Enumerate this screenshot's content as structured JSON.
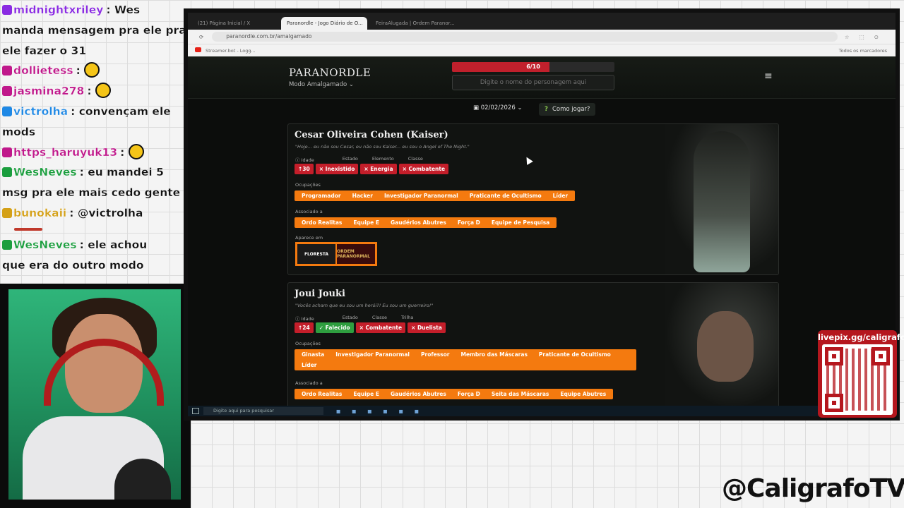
{
  "chat": {
    "messages": [
      {
        "user": "midnightxriley",
        "color": "#8a2be2",
        "text": ": Wes"
      },
      {
        "user": "",
        "color": "#111",
        "text": "manda mensagem pra ele pra"
      },
      {
        "user": "",
        "color": "#111",
        "text": "ele fazer o 31"
      },
      {
        "user": "dollietess",
        "color": "#c0188b",
        "text": ":"
      },
      {
        "user": "jasmina278",
        "color": "#c0188b",
        "text": ":"
      },
      {
        "user": "victrolha",
        "color": "#1e88e5",
        "text": ": convençam ele"
      },
      {
        "user": "",
        "color": "#111",
        "text": "mods"
      },
      {
        "user": "https_haruyuk13",
        "color": "#c0188b",
        "text": ":"
      },
      {
        "user": "WesNeves",
        "color": "#1b9e3e",
        "text": ": eu mandei 5"
      },
      {
        "user": "",
        "color": "#111",
        "text": "msg pra ele mais cedo gente"
      },
      {
        "user": "bunokaii",
        "color": "#d4a017",
        "text": ": @victrolha"
      },
      {
        "user": "WesNeves",
        "color": "#1b9e3e",
        "text": ": ele achou"
      },
      {
        "user": "",
        "color": "#111",
        "text": "que era do outro modo"
      }
    ]
  },
  "browser": {
    "tabs": [
      "(21) Página Inicial / X",
      "Paranordle - Jogo Diário de O...",
      "FeiraAlugada | Ordem Paranor..."
    ],
    "url": "paranordle.com.br/amalgamado",
    "bookmark": "Streamer.bot - Logg...",
    "bookmarks_right": "Todos os marcadores"
  },
  "site": {
    "logo": "PARANORDLE",
    "mode": "Modo Amalgamado",
    "progress_label": "6/10",
    "progress_fraction": 0.6,
    "search_placeholder": "Digite o nome do personagem aqui",
    "date": "02/02/2026",
    "howto": "Como jogar?"
  },
  "cards": [
    {
      "name": "Cesar Oliveira Cohen (Kaiser)",
      "quote": "\"Hoje... eu não sou Cesar, eu não sou Kaiser... eu sou o Angel of The Night.\"",
      "headers": [
        "Idade",
        "Estado",
        "Elemento",
        "Classe"
      ],
      "chips": [
        {
          "label": "↑30",
          "color": "red"
        },
        {
          "label": "× Inexistido",
          "color": "red"
        },
        {
          "label": "× Energia",
          "color": "red"
        },
        {
          "label": "× Combatente",
          "color": "red"
        }
      ],
      "occupations_label": "Ocupações",
      "occupations": [
        "Programador",
        "Hacker",
        "Investigador Paranormal",
        "Praticante de Ocultismo",
        "Líder"
      ],
      "associated_label": "Associado a",
      "associated": [
        "Ordo Realitas",
        "Equipe E",
        "Gaudérios Abutres",
        "Força D",
        "Equipe de Pesquisa"
      ],
      "appears_label": "Aparece em",
      "appears": [
        "FLORESTA",
        "ORDEM PARANORMAL"
      ]
    },
    {
      "name": "Joui Jouki",
      "quote": "\"Vocês acham que eu sou um herói?! Eu sou um guerreiro!\"",
      "headers": [
        "Idade",
        "Estado",
        "Classe",
        "Trilha"
      ],
      "chips": [
        {
          "label": "↑24",
          "color": "red"
        },
        {
          "label": "✓ Falecido",
          "color": "green"
        },
        {
          "label": "× Combatente",
          "color": "red"
        },
        {
          "label": "× Duelista",
          "color": "red"
        }
      ],
      "occupations_label": "Ocupações",
      "occupations": [
        "Ginasta",
        "Investigador Paranormal",
        "Professor",
        "Membro das Máscaras",
        "Praticante de Ocultismo",
        "Líder"
      ],
      "associated_label": "Associado a",
      "associated": [
        "Ordo Realitas",
        "Equipe E",
        "Gaudérios Abutres",
        "Força D",
        "Seita das Máscaras",
        "Equipe Abutres"
      ]
    }
  ],
  "taskbar": {
    "search_placeholder": "Digite aqui para pesquisar"
  },
  "livepix": {
    "label": "livepix.gg/caligrafo"
  },
  "watermark": {
    "handle": "@CaligrafoTV"
  }
}
